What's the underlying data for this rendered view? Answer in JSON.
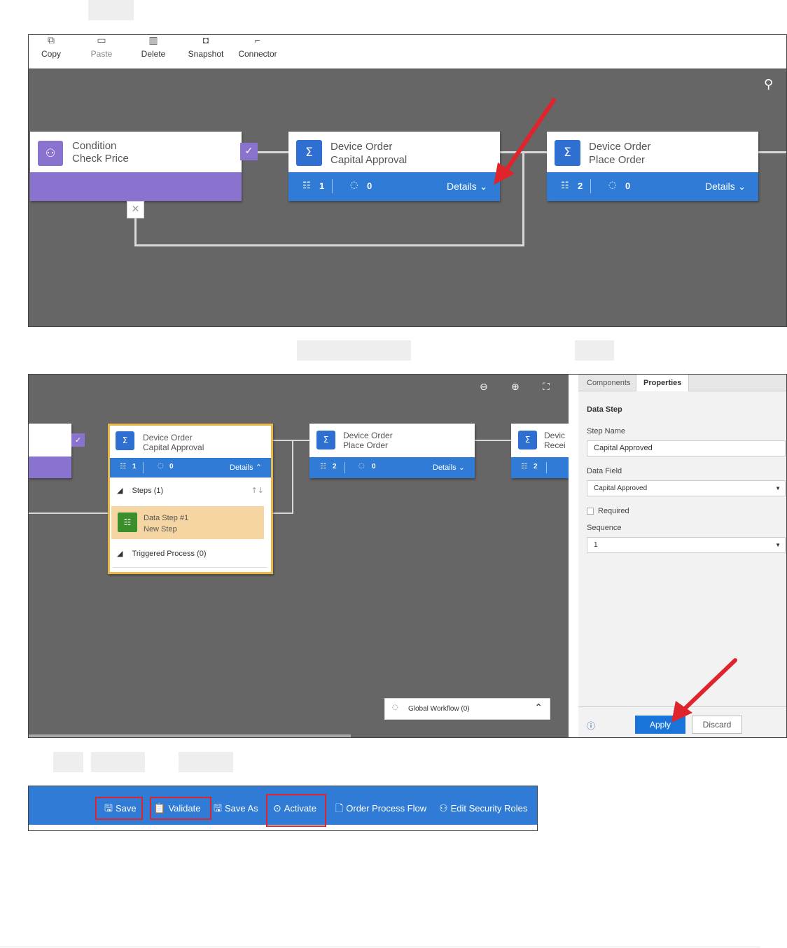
{
  "ribbon": {
    "items": [
      {
        "label": "Copy",
        "icon": "copy-icon"
      },
      {
        "label": "Paste",
        "icon": "paste-icon"
      },
      {
        "label": "Delete",
        "icon": "delete-icon"
      },
      {
        "label": "Snapshot",
        "icon": "snapshot-icon"
      },
      {
        "label": "Connector",
        "icon": "connector-icon"
      }
    ]
  },
  "canvas1": {
    "condition": {
      "title": "Condition",
      "subtitle": "Check Price"
    },
    "stage_capital": {
      "title": "Device Order",
      "subtitle": "Capital Approval",
      "steps": "1",
      "workflows": "0",
      "details": "Details"
    },
    "stage_place": {
      "title": "Device Order",
      "subtitle": "Place Order",
      "steps": "2",
      "workflows": "0",
      "details": "Details"
    }
  },
  "canvas2": {
    "stage_capital": {
      "title": "Device Order",
      "subtitle": "Capital Approval",
      "steps": "1",
      "workflows": "0",
      "details": "Details"
    },
    "stage_place": {
      "title": "Device Order",
      "subtitle": "Place Order",
      "steps": "2",
      "workflows": "0",
      "details": "Details"
    },
    "stage_receive": {
      "title": "Devic",
      "subtitle": "Recei",
      "steps": "2"
    },
    "steps_header": "Steps (1)",
    "data_step": {
      "title": "Data Step #1",
      "subtitle": "New Step"
    },
    "triggered": "Triggered Process (0)",
    "global_workflow": "Global Workflow (0)"
  },
  "properties": {
    "tabs": [
      "Components",
      "Properties"
    ],
    "section": "Data Step",
    "step_name_label": "Step Name",
    "step_name_value": "Capital Approved",
    "data_field_label": "Data Field",
    "data_field_value": "Capital Approved",
    "required_label": "Required",
    "sequence_label": "Sequence",
    "sequence_value": "1",
    "apply": "Apply",
    "discard": "Discard"
  },
  "toolbar": {
    "save": "Save",
    "validate": "Validate",
    "save_as": "Save As",
    "activate": "Activate",
    "order_process_flow": "Order Process Flow",
    "edit_security_roles": "Edit Security Roles"
  },
  "colors": {
    "accent_blue": "#2f7bd6",
    "condition_purple": "#8a72cf",
    "canvas_gray": "#666666",
    "highlight_red": "#e0242b",
    "selected_gold": "#e8b84a"
  }
}
